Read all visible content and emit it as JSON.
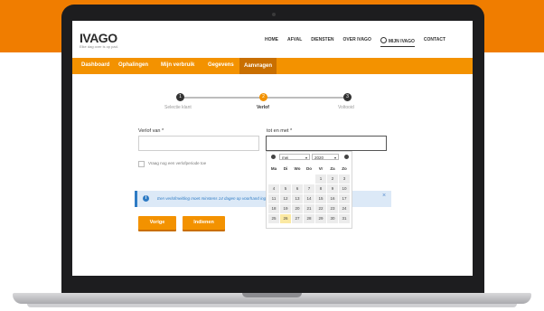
{
  "site": {
    "logo": "IVAGO",
    "tagline": "Elke dag over is op pad."
  },
  "topnav": [
    "HOME",
    "AFVAL",
    "DIENSTEN",
    "OVER IVAGO",
    "MIJN IVAGO",
    "CONTACT"
  ],
  "subnav": [
    "Dashboard",
    "Ophalingen",
    "Mijn verbruik",
    "Gegevens",
    "Aanvragen"
  ],
  "stepper": {
    "steps": [
      {
        "num": "1",
        "label": "Selectie klant"
      },
      {
        "num": "2",
        "label": "Verlof"
      },
      {
        "num": "3",
        "label": "Voltooid"
      }
    ],
    "current": 1
  },
  "form": {
    "from_label": "Verlof van *",
    "to_label": "tot en met *",
    "checkbox_label": "Vraag nog een verlofperiode toe",
    "info_text": "Een verlofmelding moet minstens 14 dagen op voorhand ingediend worden.",
    "info_icon": "i",
    "close_icon": "×",
    "back_button": "Vorige",
    "submit_button": "Indienen"
  },
  "datepicker": {
    "month": "mei",
    "year": "2020",
    "caret": "▾",
    "weekdays": [
      "Ma",
      "Di",
      "Wo",
      "Do",
      "Vr",
      "Za",
      "Zo"
    ],
    "days": [
      "",
      "",
      "",
      "",
      "1",
      "2",
      "3",
      "4",
      "5",
      "6",
      "7",
      "8",
      "9",
      "10",
      "11",
      "12",
      "13",
      "14",
      "15",
      "16",
      "17",
      "18",
      "19",
      "20",
      "21",
      "22",
      "23",
      "24",
      "25",
      "26",
      "27",
      "28",
      "29",
      "30",
      "31"
    ],
    "today": "26"
  },
  "colors": {
    "accent": "#f39200",
    "band": "#f07d00",
    "info": "#2e7bc4"
  }
}
